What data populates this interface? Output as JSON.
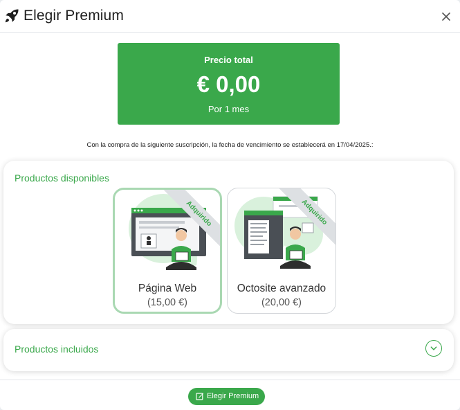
{
  "modal": {
    "title": "Elegir Premium",
    "icon": "rocket-icon",
    "close_icon": "close-icon"
  },
  "price": {
    "label": "Precio total",
    "value": "€ 0,00",
    "period": "Por 1 mes"
  },
  "notice": "Con la compra de la siguiente suscripción, la fecha de vencimiento se establecerá en 17/04/2025.:",
  "available": {
    "title": "Productos disponibles",
    "products": [
      {
        "name": "Página Web",
        "price": "(15,00 €)",
        "badge": "Adquirido",
        "selected": true
      },
      {
        "name": "Octosite avanzado",
        "price": "(20,00 €)",
        "badge": "Adquirido",
        "selected": false
      }
    ]
  },
  "included": {
    "title": "Productos incluidos",
    "toggle_icon": "chevron-down-icon"
  },
  "footer": {
    "button_label": "Elegir Premium",
    "button_icon": "edit-icon"
  },
  "colors": {
    "accent": "#3aa84b",
    "accent_light": "#a9d8b2",
    "ribbon": "#dde0e3"
  }
}
